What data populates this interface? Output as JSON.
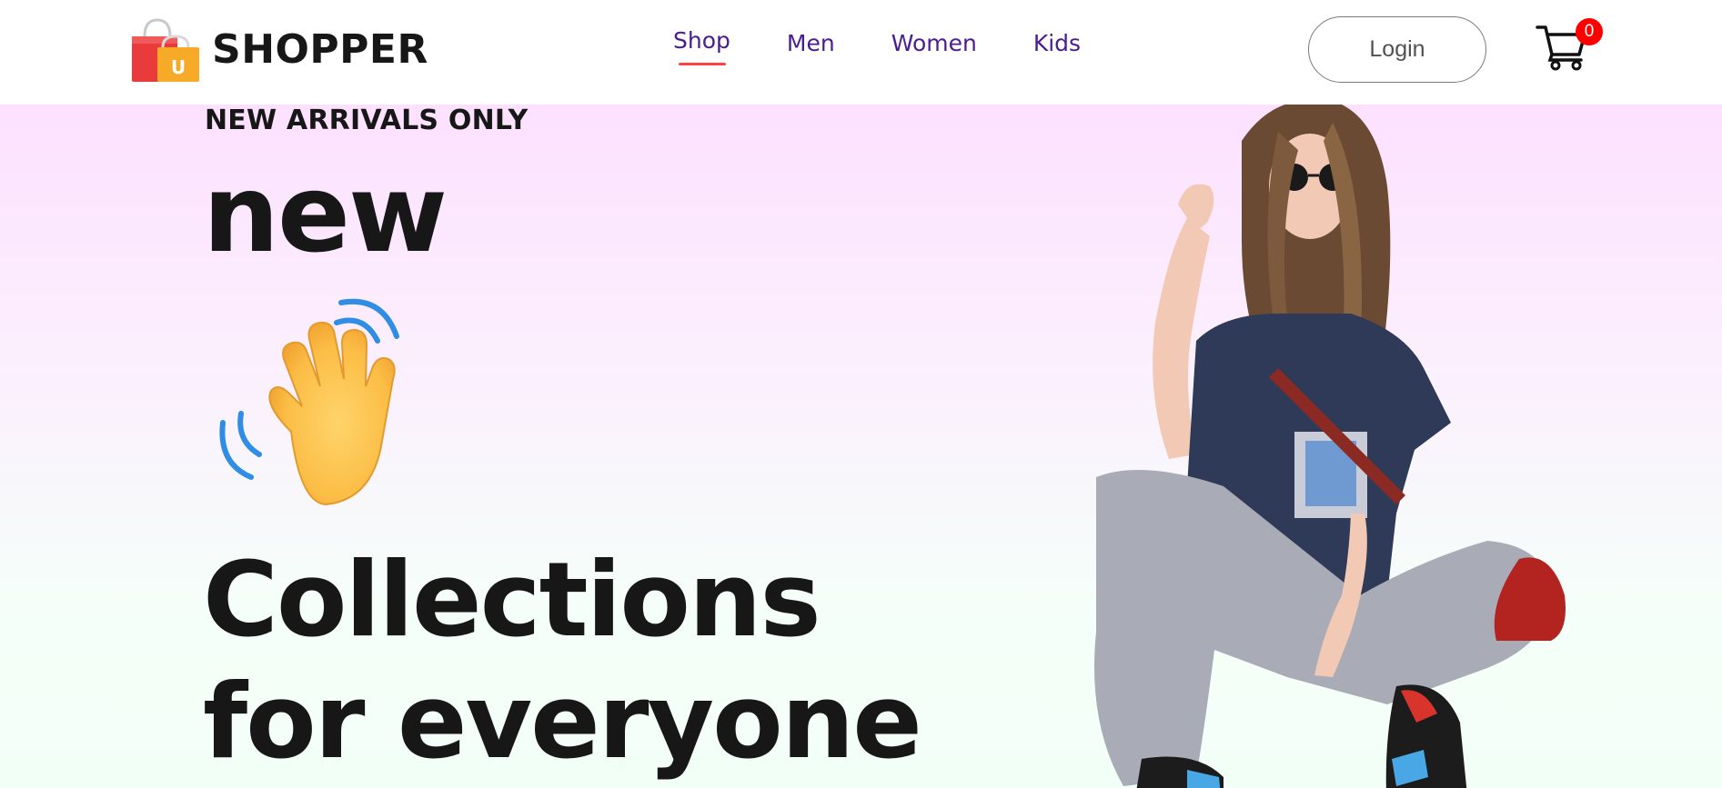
{
  "navbar": {
    "brand_name": "SHOPPER",
    "logo_icon": "shopping-bag-icon",
    "logo_letter": "U",
    "menu": [
      {
        "label": "Shop",
        "active": true
      },
      {
        "label": "Men",
        "active": false
      },
      {
        "label": "Women",
        "active": false
      },
      {
        "label": "Kids",
        "active": false
      }
    ],
    "login_label": "Login",
    "cart_icon": "cart-icon",
    "cart_count": "0"
  },
  "hero": {
    "tag": "NEW ARRIVALS ONLY",
    "word_new": "new",
    "hand_icon": "waving-hand-icon",
    "line_1": "Collections",
    "line_2": "for everyone",
    "figure": "model-photo"
  },
  "colors": {
    "nav_text": "#4b1c8f",
    "active_underline": "#ff4141",
    "badge": "#ff0000",
    "hero_top": "#fde1ff",
    "hero_bottom": "#f2fff7",
    "text_dark": "#171717"
  }
}
